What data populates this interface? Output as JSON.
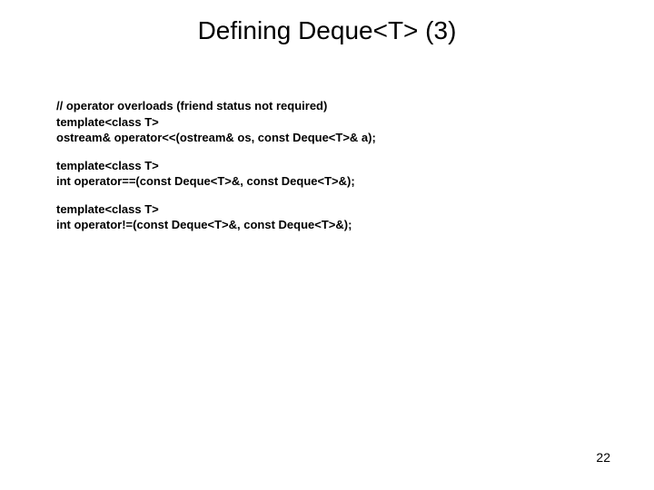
{
  "title": "Defining Deque<T> (3)",
  "code": {
    "block1": {
      "l1": "// operator overloads (friend status not required)",
      "l2": "template<class T>",
      "l3": "ostream& operator<<(ostream& os, const Deque<T>& a);"
    },
    "block2": {
      "l1": "template<class T>",
      "l2": "int operator==(const Deque<T>&, const Deque<T>&);"
    },
    "block3": {
      "l1": "template<class T>",
      "l2": "int operator!=(const Deque<T>&, const Deque<T>&);"
    }
  },
  "page_number": "22"
}
